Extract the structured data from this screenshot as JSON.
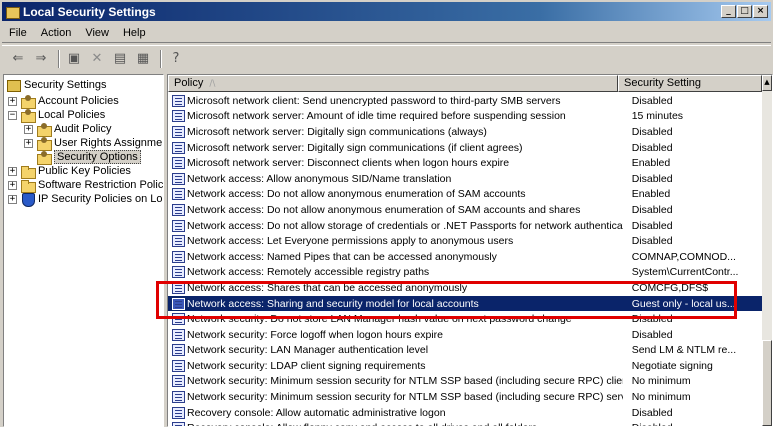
{
  "window": {
    "title": "Local Security Settings",
    "controls": {
      "minimize": "_",
      "maximize": "□",
      "close": "×"
    }
  },
  "menu": [
    "File",
    "Action",
    "View",
    "Help"
  ],
  "toolbar": [
    "back-arrow-icon",
    "forward-arrow-icon",
    "up-folder-icon",
    "delete-icon",
    "properties-icon",
    "export-list-icon",
    "help-icon"
  ],
  "tree": {
    "root": "Security Settings",
    "items": [
      {
        "label": "Account Policies",
        "expander": "+"
      },
      {
        "label": "Local Policies",
        "expander": "−"
      },
      {
        "label": "Audit Policy",
        "expander": "+"
      },
      {
        "label": "User Rights Assignment",
        "expander": "+"
      },
      {
        "label": "Security Options",
        "expander": ""
      },
      {
        "label": "Public Key Policies",
        "expander": "+"
      },
      {
        "label": "Software Restriction Policies",
        "expander": "+"
      },
      {
        "label": "IP Security Policies on Local Computer",
        "expander": "+"
      }
    ]
  },
  "list": {
    "columns": {
      "policy": "Policy",
      "setting": "Security Setting",
      "sort_indicator": "/\\"
    },
    "rows": [
      {
        "policy": "Microsoft network client: Send unencrypted password to third-party SMB servers",
        "setting": "Disabled"
      },
      {
        "policy": "Microsoft network server: Amount of idle time required before suspending session",
        "setting": "15 minutes"
      },
      {
        "policy": "Microsoft network server: Digitally sign communications (always)",
        "setting": "Disabled"
      },
      {
        "policy": "Microsoft network server: Digitally sign communications (if client agrees)",
        "setting": "Disabled"
      },
      {
        "policy": "Microsoft network server: Disconnect clients when logon hours expire",
        "setting": "Enabled"
      },
      {
        "policy": "Network access: Allow anonymous SID/Name translation",
        "setting": "Disabled"
      },
      {
        "policy": "Network access: Do not allow anonymous enumeration of SAM accounts",
        "setting": "Enabled"
      },
      {
        "policy": "Network access: Do not allow anonymous enumeration of SAM accounts and shares",
        "setting": "Disabled"
      },
      {
        "policy": "Network access: Do not allow storage of credentials or .NET Passports for network authentication",
        "setting": "Disabled"
      },
      {
        "policy": "Network access: Let Everyone permissions apply to anonymous users",
        "setting": "Disabled"
      },
      {
        "policy": "Network access: Named Pipes that can be accessed anonymously",
        "setting": "COMNAP,COMNOD..."
      },
      {
        "policy": "Network access: Remotely accessible registry paths",
        "setting": "System\\CurrentContr..."
      },
      {
        "policy": "Network access: Shares that can be accessed anonymously",
        "setting": "COMCFG,DFS$"
      },
      {
        "policy": "Network access: Sharing and security model for local accounts",
        "setting": "Guest only - local us...",
        "selected": true
      },
      {
        "policy": "Network security: Do not store LAN Manager hash value on next password change",
        "setting": "Disabled"
      },
      {
        "policy": "Network security: Force logoff when logon hours expire",
        "setting": "Disabled"
      },
      {
        "policy": "Network security: LAN Manager authentication level",
        "setting": "Send LM & NTLM re..."
      },
      {
        "policy": "Network security: LDAP client signing requirements",
        "setting": "Negotiate signing"
      },
      {
        "policy": "Network security: Minimum session security for NTLM SSP based (including secure RPC) clients",
        "setting": "No minimum"
      },
      {
        "policy": "Network security: Minimum session security for NTLM SSP based (including secure RPC) servers",
        "setting": "No minimum"
      },
      {
        "policy": "Recovery console: Allow automatic administrative logon",
        "setting": "Disabled"
      },
      {
        "policy": "Recovery console: Allow floppy copy and access to all drives and all folders",
        "setting": "Disabled"
      }
    ]
  },
  "colors": {
    "selection": "#0a246a",
    "highlight_box": "#e00000"
  }
}
